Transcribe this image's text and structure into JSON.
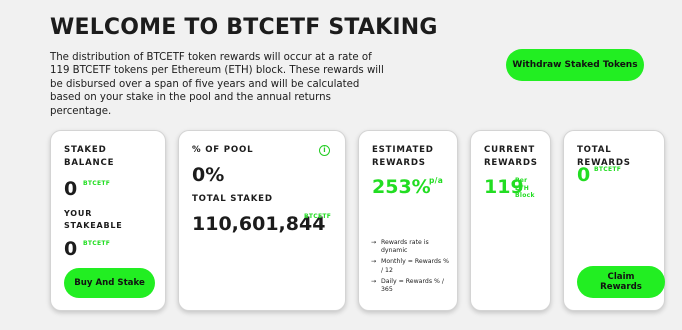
{
  "header": {
    "title": "WELCOME TO BTCETF STAKING",
    "description": "The distribution of BTCETF token rewards will occur at a rate of 119 BTCETF tokens per Ethereum (ETH) block. These rewards will be disbursed over a span of five years and will be calculated based on your stake in the pool and the annual returns percentage.",
    "withdraw_label": "Withdraw Staked Tokens"
  },
  "cards": {
    "staked": {
      "label": "STAKED BALANCE",
      "value": "0",
      "unit": "BTCETF",
      "stakeable_label": "YOUR STAKEABLE",
      "stakeable_value": "0",
      "stakeable_unit": "BTCETF",
      "button": "Buy And Stake"
    },
    "pool": {
      "label": "% OF POOL",
      "value": "0%",
      "info_icon": "info-icon",
      "total_label": "TOTAL STAKED",
      "total_value": "110,601,844",
      "total_unit": "BTCETF"
    },
    "estimated": {
      "label": "ESTIMATED REWARDS",
      "value": "253%",
      "unit": "p/a",
      "notes": [
        "Rewards rate is dynamic",
        "Monthly = Rewards % / 12",
        "Daily = Rewards % / 365"
      ],
      "arrow": "→"
    },
    "current": {
      "label": "CURRENT REWARDS",
      "value": "119",
      "unit": "Per ETH Block"
    },
    "total": {
      "label": "TOTAL REWARDS",
      "value": "0",
      "unit": "BTCETF",
      "button": "Claim Rewards"
    }
  },
  "colors": {
    "accent": "#22ee22",
    "background": "#f1f1f1",
    "text": "#1c1c1c"
  }
}
